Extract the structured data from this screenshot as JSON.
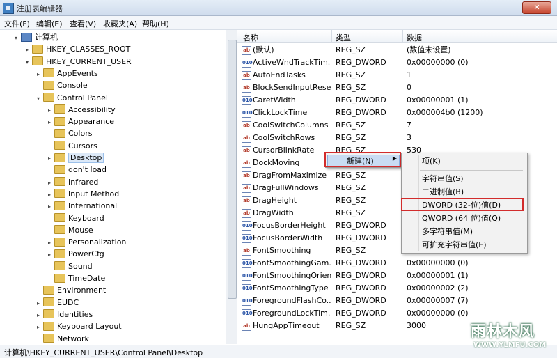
{
  "window": {
    "title": "注册表编辑器"
  },
  "menu": [
    "文件(F)",
    "编辑(E)",
    "查看(V)",
    "收藏夹(A)",
    "帮助(H)"
  ],
  "tree": [
    {
      "label": "计算机",
      "level": 0,
      "icon": "computer-icon",
      "exp": "▾"
    },
    {
      "label": "HKEY_CLASSES_ROOT",
      "level": 1,
      "exp": "▸"
    },
    {
      "label": "HKEY_CURRENT_USER",
      "level": 1,
      "exp": "▾"
    },
    {
      "label": "AppEvents",
      "level": 2,
      "exp": "▸"
    },
    {
      "label": "Console",
      "level": 2,
      "exp": ""
    },
    {
      "label": "Control Panel",
      "level": 2,
      "exp": "▾"
    },
    {
      "label": "Accessibility",
      "level": 3,
      "exp": "▸"
    },
    {
      "label": "Appearance",
      "level": 3,
      "exp": "▸"
    },
    {
      "label": "Colors",
      "level": 3,
      "exp": ""
    },
    {
      "label": "Cursors",
      "level": 3,
      "exp": ""
    },
    {
      "label": "Desktop",
      "level": 3,
      "exp": "▸",
      "selected": true
    },
    {
      "label": "don't load",
      "level": 3,
      "exp": ""
    },
    {
      "label": "Infrared",
      "level": 3,
      "exp": "▸"
    },
    {
      "label": "Input Method",
      "level": 3,
      "exp": "▸"
    },
    {
      "label": "International",
      "level": 3,
      "exp": "▸"
    },
    {
      "label": "Keyboard",
      "level": 3,
      "exp": ""
    },
    {
      "label": "Mouse",
      "level": 3,
      "exp": ""
    },
    {
      "label": "Personalization",
      "level": 3,
      "exp": "▸"
    },
    {
      "label": "PowerCfg",
      "level": 3,
      "exp": "▸"
    },
    {
      "label": "Sound",
      "level": 3,
      "exp": ""
    },
    {
      "label": "TimeDate",
      "level": 3,
      "exp": ""
    },
    {
      "label": "Environment",
      "level": 2,
      "exp": ""
    },
    {
      "label": "EUDC",
      "level": 2,
      "exp": "▸"
    },
    {
      "label": "Identities",
      "level": 2,
      "exp": "▸"
    },
    {
      "label": "Keyboard Layout",
      "level": 2,
      "exp": "▸"
    },
    {
      "label": "Network",
      "level": 2,
      "exp": ""
    }
  ],
  "columns": {
    "name": "名称",
    "type": "类型",
    "data": "数据"
  },
  "values": [
    {
      "name": "(默认)",
      "type": "REG_SZ",
      "data": "(数值未设置)",
      "kind": "sz"
    },
    {
      "name": "ActiveWndTrackTim...",
      "type": "REG_DWORD",
      "data": "0x00000000 (0)",
      "kind": "dw"
    },
    {
      "name": "AutoEndTasks",
      "type": "REG_SZ",
      "data": "1",
      "kind": "sz"
    },
    {
      "name": "BlockSendInputResets",
      "type": "REG_SZ",
      "data": "0",
      "kind": "sz"
    },
    {
      "name": "CaretWidth",
      "type": "REG_DWORD",
      "data": "0x00000001 (1)",
      "kind": "dw"
    },
    {
      "name": "ClickLockTime",
      "type": "REG_DWORD",
      "data": "0x000004b0 (1200)",
      "kind": "dw"
    },
    {
      "name": "CoolSwitchColumns",
      "type": "REG_SZ",
      "data": "7",
      "kind": "sz"
    },
    {
      "name": "CoolSwitchRows",
      "type": "REG_SZ",
      "data": "3",
      "kind": "sz"
    },
    {
      "name": "CursorBlinkRate",
      "type": "REG_SZ",
      "data": "530",
      "kind": "sz"
    },
    {
      "name": "DockMoving",
      "type": "",
      "data": "",
      "kind": "sz"
    },
    {
      "name": "DragFromMaximize",
      "type": "REG_SZ",
      "data": "",
      "kind": "sz"
    },
    {
      "name": "DragFullWindows",
      "type": "REG_SZ",
      "data": "",
      "kind": "sz"
    },
    {
      "name": "DragHeight",
      "type": "REG_SZ",
      "data": "",
      "kind": "sz"
    },
    {
      "name": "DragWidth",
      "type": "REG_SZ",
      "data": "",
      "kind": "sz"
    },
    {
      "name": "FocusBorderHeight",
      "type": "REG_DWORD",
      "data": "",
      "kind": "dw"
    },
    {
      "name": "FocusBorderWidth",
      "type": "REG_DWORD",
      "data": "",
      "kind": "dw"
    },
    {
      "name": "FontSmoothing",
      "type": "REG_SZ",
      "data": "",
      "kind": "sz"
    },
    {
      "name": "FontSmoothingGam...",
      "type": "REG_DWORD",
      "data": "0x00000000 (0)",
      "kind": "dw"
    },
    {
      "name": "FontSmoothingOrien...",
      "type": "REG_DWORD",
      "data": "0x00000001 (1)",
      "kind": "dw"
    },
    {
      "name": "FontSmoothingType",
      "type": "REG_DWORD",
      "data": "0x00000002 (2)",
      "kind": "dw"
    },
    {
      "name": "ForegroundFlashCo...",
      "type": "REG_DWORD",
      "data": "0x00000007 (7)",
      "kind": "dw"
    },
    {
      "name": "ForegroundLockTim...",
      "type": "REG_DWORD",
      "data": "0x00000000 (0)",
      "kind": "dw"
    },
    {
      "name": "HungAppTimeout",
      "type": "REG_SZ",
      "data": "3000",
      "kind": "sz"
    }
  ],
  "context_menu": {
    "new_label": "新建(N)"
  },
  "submenu": [
    {
      "label": "项(K)",
      "sep_after": true
    },
    {
      "label": "字符串值(S)"
    },
    {
      "label": "二进制值(B)"
    },
    {
      "label": "DWORD (32-位)值(D)",
      "highlighted": true
    },
    {
      "label": "QWORD (64 位)值(Q)"
    },
    {
      "label": "多字符串值(M)"
    },
    {
      "label": "可扩充字符串值(E)"
    }
  ],
  "status": {
    "path": "计算机\\HKEY_CURRENT_USER\\Control Panel\\Desktop"
  },
  "watermark": {
    "text": "雨林木风",
    "url": "WWW.YLMFU.COM"
  }
}
